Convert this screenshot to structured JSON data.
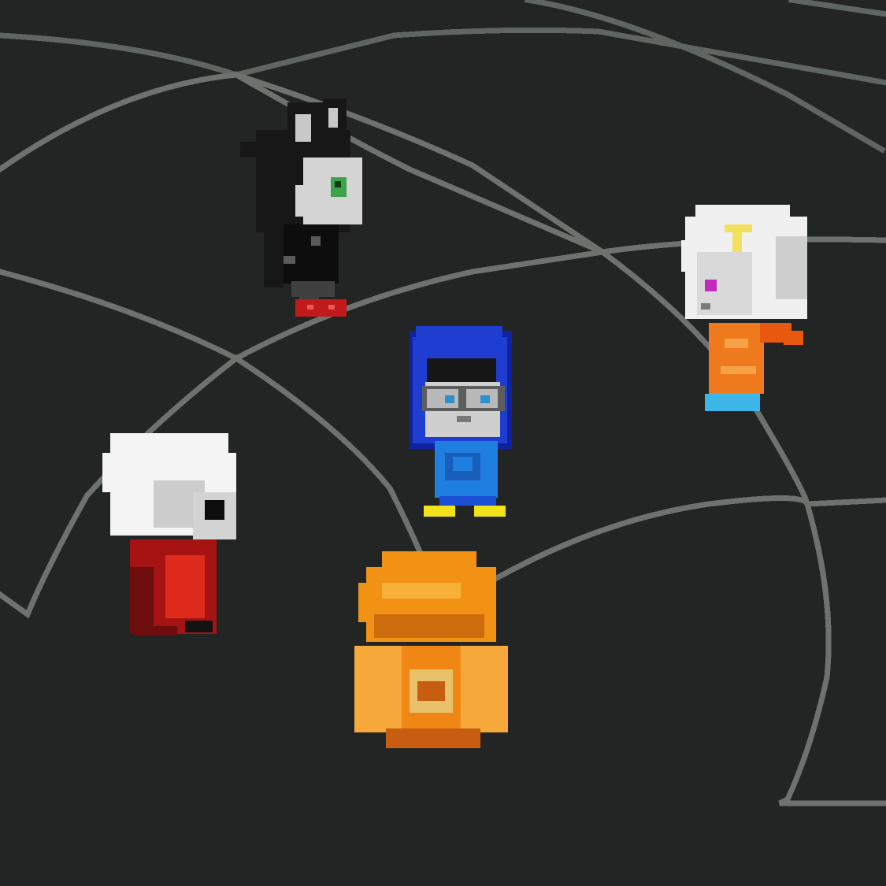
{
  "scene": {
    "background_color": "#232524",
    "web_line_color": "#6d726f",
    "web_line_color_far": "#5f6561"
  },
  "characters": [
    {
      "id": "cat-girl",
      "icon": "cat-eared-girl-sprite",
      "colors": {
        "hair": "#171717",
        "ear_inner": "#c8c8c8",
        "skin": "#d4d4d4",
        "eye": "#3fa24a",
        "dress": "#0d0d0d",
        "dress_shine": "#5a5a5a",
        "legs": "#404040",
        "shoes": "#c11a1a"
      }
    },
    {
      "id": "blue-hood-boy",
      "icon": "blue-hooded-boy-with-glasses-sprite",
      "colors": {
        "hood": "#1f3ed1",
        "hood_outline": "#1122a0",
        "hair": "#161616",
        "skin": "#cfcfcf",
        "glasses": "#5d5d5d",
        "lens": "#b9b9b9",
        "eye": "#2f8fd0",
        "shirt": "#1f7fe0",
        "shirt_dark": "#175fb8",
        "pants": "#1a4fd6",
        "shoes": "#f2e21a"
      }
    },
    {
      "id": "blonde-girl",
      "icon": "white-hooded-girl-sprite",
      "colors": {
        "hood": "#f0f0f0",
        "hood_shade": "#cfcfcf",
        "hair": "#f3e05c",
        "skin": "#d9d9d9",
        "eye": "#c42abf",
        "outfit": "#ef7a1e",
        "outfit_light": "#f6a348",
        "scarf": "#e8580f",
        "shoes": "#3fb6e8"
      }
    },
    {
      "id": "red-boy",
      "icon": "white-haired-boy-red-outfit-sprite",
      "colors": {
        "hair": "#f4f4f4",
        "hair_shade": "#cccccc",
        "skin": "#d3d3d3",
        "glasses": "#0e0e0e",
        "outfit": "#a61313",
        "outfit_light": "#dd2a1a",
        "outfit_dark": "#6e0d0d",
        "shoes": "#131313"
      }
    },
    {
      "id": "orange-back-boy",
      "icon": "orange-haired-boy-from-behind-sprite",
      "colors": {
        "hair": "#f29214",
        "hair_light": "#f7b13a",
        "hair_dark": "#cc6c0d",
        "shirt": "#f08614",
        "shirt_light": "#f7a83b",
        "shirt_dark": "#c75d10",
        "accent": "#e8c26a"
      }
    }
  ]
}
